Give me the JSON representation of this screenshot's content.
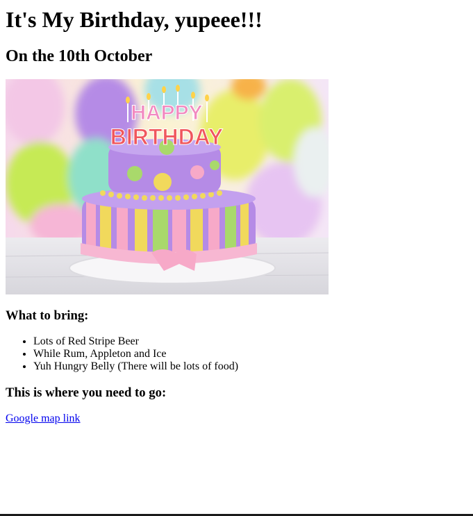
{
  "page": {
    "title": "It's My Birthday, yupeee!!!",
    "date": "On the 10th October"
  },
  "image": {
    "cake_text_top": "HAPPY",
    "cake_text_bottom": "BIRTHDAY"
  },
  "bring": {
    "heading": "What to bring:",
    "items": [
      "Lots of Red Stripe Beer",
      "While Rum, Appleton and Ice",
      "Yuh Hungry Belly (There will be lots of food)"
    ]
  },
  "directions": {
    "heading": "This is where you need to go:",
    "link_text": "Google map link"
  }
}
